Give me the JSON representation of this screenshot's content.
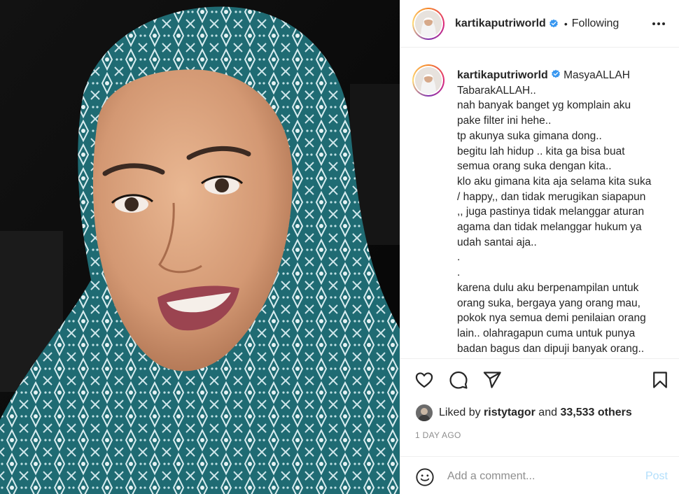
{
  "post": {
    "username": "kartikaputriworld",
    "verified": true,
    "follow_separator": "•",
    "follow_status": "Following",
    "more_icon": "more-horizontal-icon"
  },
  "caption": {
    "username": "kartikaputriworld",
    "text": "MasyaALLAH\nTabarakALLAH..\nnah banyak banget yg komplain aku\npake filter ini hehe..\ntp akunya suka gimana dong..\nbegitu lah hidup .. kita ga bisa buat\nsemua orang suka dengan kita..\nklo aku gimana kita aja selama kita suka\n/ happy,, dan tidak merugikan siapapun\n,, juga pastinya tidak melanggar aturan\nagama dan tidak melanggar hukum ya\nudah santai aja..\n.\n.\nkarena dulu aku berpenampilan untuk\norang suka, bergaya yang orang mau,\npokok nya semua demi penilaian orang\nlain.. olahragapun cuma untuk punya\nbadan bagus dan dipuji banyak orang.."
  },
  "actions": {
    "like_icon": "heart-icon",
    "comment_icon": "comment-icon",
    "share_icon": "send-icon",
    "save_icon": "bookmark-icon"
  },
  "likes": {
    "prefix": "Liked by",
    "user": "ristytagor",
    "middle": "and",
    "others": "33,533 others"
  },
  "timestamp": "1 DAY AGO",
  "comment": {
    "placeholder": "Add a comment...",
    "post_label": "Post",
    "emoji_icon": "smiley-icon"
  },
  "colors": {
    "verified_blue": "#3897f0",
    "post_button_disabled": "#b2dffc",
    "muted_text": "#8e8e8e",
    "scarf_teal": "#1f6b73"
  }
}
